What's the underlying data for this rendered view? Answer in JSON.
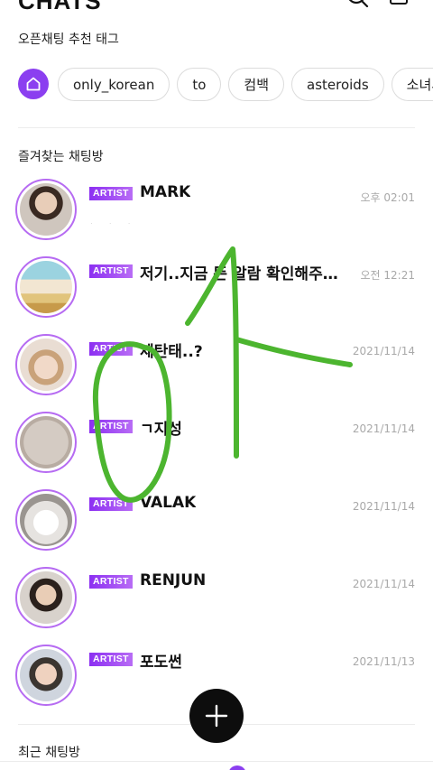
{
  "header": {
    "title": "CHATS",
    "search_icon": "search-icon",
    "compose_icon": "compose-icon"
  },
  "recommended": {
    "title": "오픈채팅 추천 태그",
    "tags": [
      "only_korean",
      "to",
      "컴백",
      "asteroids",
      "소녀시대"
    ]
  },
  "favorites": {
    "title": "즐겨찾는 채팅방",
    "badge": "ARTIST",
    "rooms": [
      {
        "name": "MARK",
        "time": "오후 02:01"
      },
      {
        "name": "저기..지금 뜬 알람 확인해주…",
        "time": "오전 12:21"
      },
      {
        "name": "세탄태..?",
        "time": "2021/11/14"
      },
      {
        "name": "ㄱ지성",
        "time": "2021/11/14"
      },
      {
        "name": "VALAK",
        "time": "2021/11/14"
      },
      {
        "name": "RENJUN",
        "time": "2021/11/14"
      },
      {
        "name": "포도썬",
        "time": "2021/11/13"
      }
    ]
  },
  "recent": {
    "title": "최근 채팅방"
  },
  "colors": {
    "accent": "#8b3ff0",
    "scribble": "#4cb52f",
    "fab": "#0d0d0d"
  }
}
